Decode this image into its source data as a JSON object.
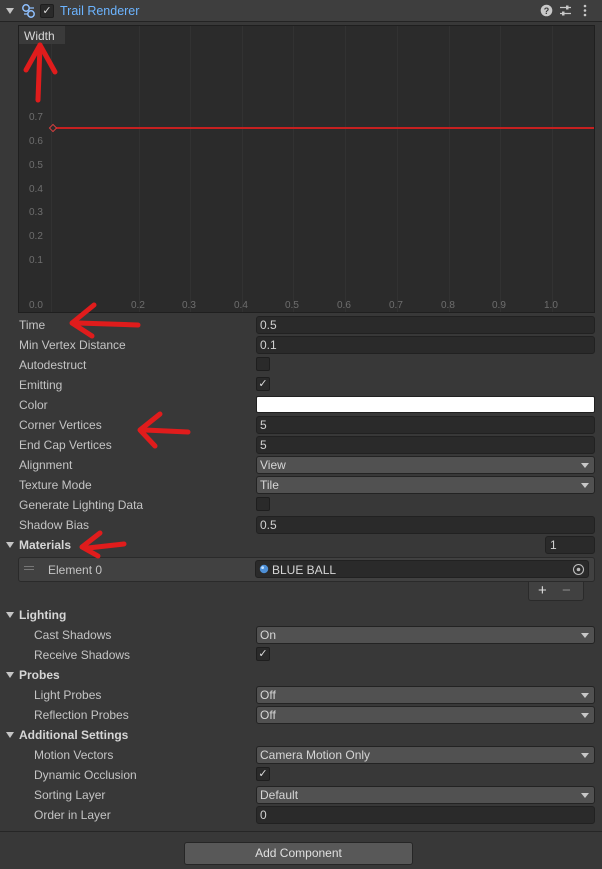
{
  "component": {
    "title": "Trail Renderer",
    "enabled_check": "✓",
    "icons": [
      "trail-renderer-icon",
      "help-icon",
      "settings-icon",
      "more-icon"
    ]
  },
  "curve": {
    "label": "Width",
    "y_ticks": [
      "0.7",
      "0.6",
      "0.5",
      "0.4",
      "0.3",
      "0.2",
      "0.1",
      "0.0"
    ],
    "x_ticks": [
      "0.0",
      "0.2",
      "0.3",
      "0.4",
      "0.5",
      "0.6",
      "0.7",
      "0.8",
      "0.9",
      "1.0"
    ],
    "curve_value": 0.65,
    "curve_color": "#c62020"
  },
  "props": {
    "time_label": "Time",
    "time_value": "0.5",
    "min_vertex_label": "Min Vertex Distance",
    "min_vertex_value": "0.1",
    "autodestruct_label": "Autodestruct",
    "emitting_label": "Emitting",
    "emitting_check": "✓",
    "color_label": "Color",
    "color_value": "#ffffff",
    "corner_label": "Corner Vertices",
    "corner_value": "5",
    "endcap_label": "End Cap Vertices",
    "endcap_value": "5",
    "alignment_label": "Alignment",
    "alignment_value": "View",
    "texture_label": "Texture Mode",
    "texture_value": "Tile",
    "genlight_label": "Generate Lighting Data",
    "shadowbias_label": "Shadow Bias",
    "shadowbias_value": "0.5"
  },
  "materials": {
    "title": "Materials",
    "count": "1",
    "element_label": "Element 0",
    "element_value": "BLUE BALL",
    "add": "+",
    "remove": "−"
  },
  "lighting": {
    "title": "Lighting",
    "cast_label": "Cast Shadows",
    "cast_value": "On",
    "receive_label": "Receive Shadows",
    "receive_check": "✓"
  },
  "probes": {
    "title": "Probes",
    "light_label": "Light Probes",
    "light_value": "Off",
    "reflection_label": "Reflection Probes",
    "reflection_value": "Off"
  },
  "additional": {
    "title": "Additional Settings",
    "motion_label": "Motion Vectors",
    "motion_value": "Camera Motion Only",
    "occlusion_label": "Dynamic Occlusion",
    "occlusion_check": "✓",
    "sorting_label": "Sorting Layer",
    "sorting_value": "Default",
    "order_label": "Order in Layer",
    "order_value": "0"
  },
  "add_component": "Add Component"
}
